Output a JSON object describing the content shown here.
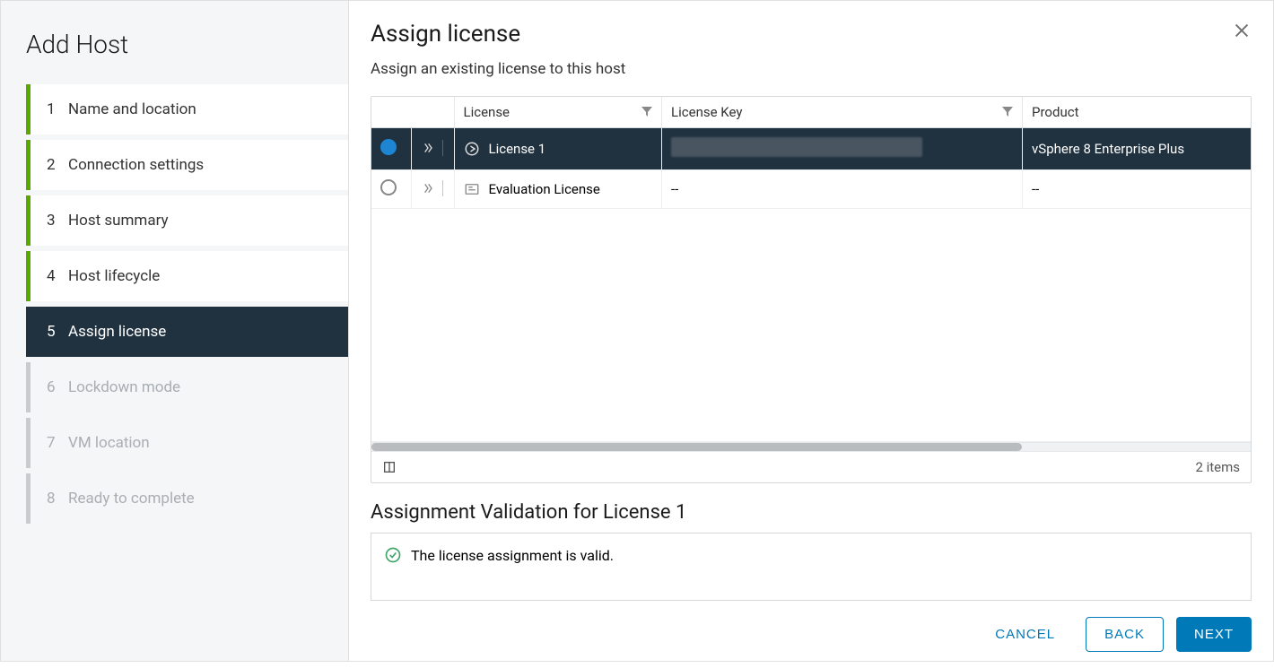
{
  "sidebar": {
    "title": "Add Host",
    "steps": [
      {
        "num": "1",
        "label": "Name and location",
        "state": "done"
      },
      {
        "num": "2",
        "label": "Connection settings",
        "state": "done"
      },
      {
        "num": "3",
        "label": "Host summary",
        "state": "done"
      },
      {
        "num": "4",
        "label": "Host lifecycle",
        "state": "done"
      },
      {
        "num": "5",
        "label": "Assign license",
        "state": "active"
      },
      {
        "num": "6",
        "label": "Lockdown mode",
        "state": "future"
      },
      {
        "num": "7",
        "label": "VM location",
        "state": "future"
      },
      {
        "num": "8",
        "label": "Ready to complete",
        "state": "future"
      }
    ]
  },
  "main": {
    "title": "Assign license",
    "subtitle": "Assign an existing license to this host",
    "columns": {
      "license": "License",
      "key": "License Key",
      "product": "Product"
    },
    "rows": [
      {
        "selected": true,
        "name": "License 1",
        "key_redacted": true,
        "key": "",
        "product": "vSphere 8 Enterprise Plus"
      },
      {
        "selected": false,
        "name": "Evaluation License",
        "key_redacted": false,
        "key": "--",
        "product": "--"
      }
    ],
    "items_count": "2 items",
    "validation": {
      "title": "Assignment Validation for License 1",
      "message": "The license assignment is valid."
    }
  },
  "footer": {
    "cancel": "CANCEL",
    "back": "BACK",
    "next": "NEXT"
  }
}
